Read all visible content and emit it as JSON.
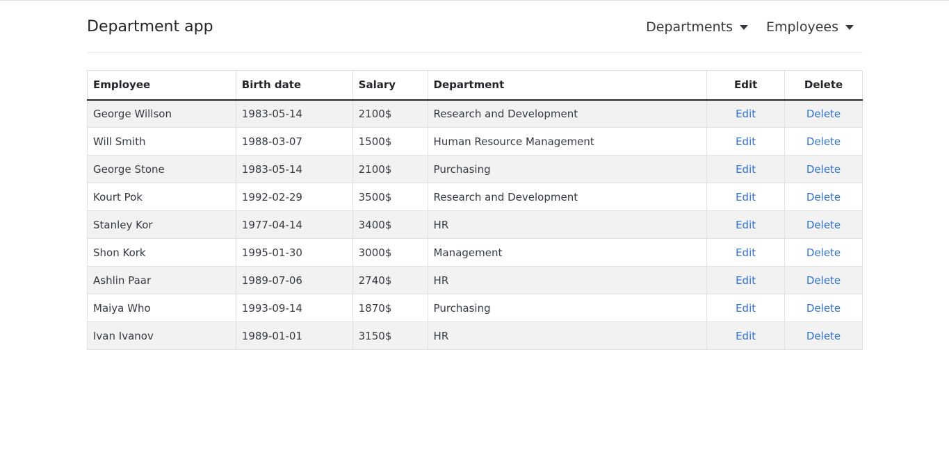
{
  "brand": "Department app",
  "nav": [
    {
      "label": "Departments"
    },
    {
      "label": "Employees"
    }
  ],
  "table": {
    "headers": {
      "employee": "Employee",
      "birth_date": "Birth date",
      "salary": "Salary",
      "department": "Department",
      "edit": "Edit",
      "delete": "Delete"
    },
    "rows": [
      {
        "name": "George Willson",
        "birth": "1983-05-14",
        "salary": "2100$",
        "department": "Research and Development",
        "edit": "Edit",
        "delete": "Delete"
      },
      {
        "name": "Will Smith",
        "birth": "1988-03-07",
        "salary": "1500$",
        "department": "Human Resource Management",
        "edit": "Edit",
        "delete": "Delete"
      },
      {
        "name": "George Stone",
        "birth": "1983-05-14",
        "salary": "2100$",
        "department": "Purchasing",
        "edit": "Edit",
        "delete": "Delete"
      },
      {
        "name": "Kourt Pok",
        "birth": "1992-02-29",
        "salary": "3500$",
        "department": "Research and Development",
        "edit": "Edit",
        "delete": "Delete"
      },
      {
        "name": "Stanley Kor",
        "birth": "1977-04-14",
        "salary": "3400$",
        "department": "HR",
        "edit": "Edit",
        "delete": "Delete"
      },
      {
        "name": "Shon Kork",
        "birth": "1995-01-30",
        "salary": "3000$",
        "department": "Management",
        "edit": "Edit",
        "delete": "Delete"
      },
      {
        "name": "Ashlin Paar",
        "birth": "1989-07-06",
        "salary": "2740$",
        "department": "HR",
        "edit": "Edit",
        "delete": "Delete"
      },
      {
        "name": "Maiya Who",
        "birth": "1993-09-14",
        "salary": "1870$",
        "department": "Purchasing",
        "edit": "Edit",
        "delete": "Delete"
      },
      {
        "name": "Ivan Ivanov",
        "birth": "1989-01-01",
        "salary": "3150$",
        "department": "HR",
        "edit": "Edit",
        "delete": "Delete"
      }
    ]
  }
}
